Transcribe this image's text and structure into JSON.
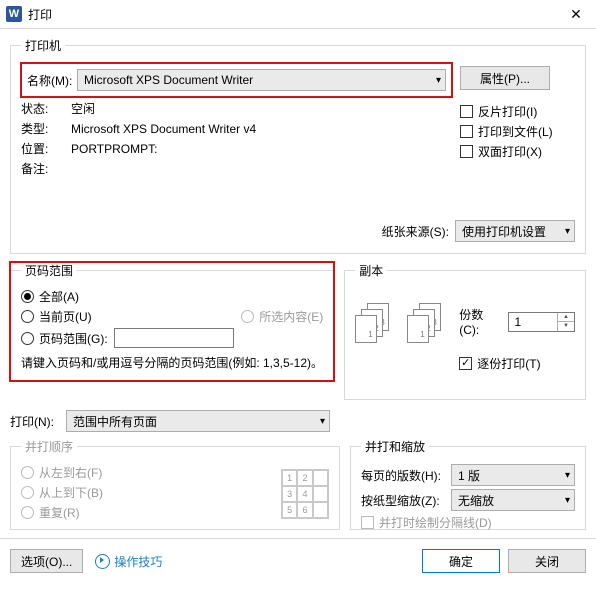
{
  "window": {
    "title": "打印",
    "app_letter": "W"
  },
  "printer": {
    "group_title": "打印机",
    "name_label": "名称(M):",
    "name_value": "Microsoft XPS Document Writer",
    "props_button": "属性(P)...",
    "status_label": "状态:",
    "status_value": "空闲",
    "type_label": "类型:",
    "type_value": "Microsoft XPS Document Writer v4",
    "where_label": "位置:",
    "where_value": "PORTPROMPT:",
    "comment_label": "备注:",
    "reverse_print": "反片打印(I)",
    "print_to_file": "打印到文件(L)",
    "duplex": "双面打印(X)"
  },
  "paper_source": {
    "label": "纸张来源(S):",
    "value": "使用打印机设置"
  },
  "page_range": {
    "group_title": "页码范围",
    "all": "全部(A)",
    "current": "当前页(U)",
    "selection": "所选内容(E)",
    "pages_label": "页码范围(G):",
    "hint": "请键入页码和/或用逗号分隔的页码范围(例如: 1,3,5-12)。"
  },
  "copies": {
    "group_title": "副本",
    "count_label": "份数(C):",
    "count_value": "1",
    "collate": "逐份打印(T)"
  },
  "print_what": {
    "label": "打印(N):",
    "value": "范围中所有页面"
  },
  "print_order": {
    "group_title": "并打顺序",
    "lr": "从左到右(F)",
    "tb": "从上到下(B)",
    "repeat": "重复(R)"
  },
  "scale": {
    "group_title": "并打和缩放",
    "per_sheet_label": "每页的版数(H):",
    "per_sheet_value": "1 版",
    "scale_label": "按纸型缩放(Z):",
    "scale_value": "无缩放",
    "draw_lines": "并打时绘制分隔线(D)"
  },
  "footer": {
    "options": "选项(O)...",
    "tips": "操作技巧",
    "ok": "确定",
    "close": "关闭"
  }
}
